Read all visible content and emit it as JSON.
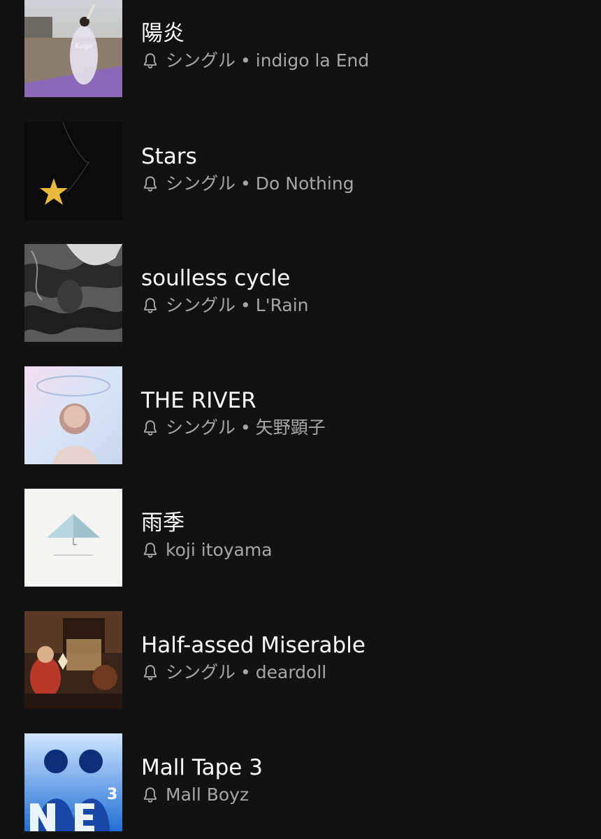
{
  "colors": {
    "background": "#121212",
    "title": "#ffffff",
    "subtitle": "#a7a7a7"
  },
  "icons": {
    "notification": "bell-icon"
  },
  "releases": [
    {
      "title": "陽炎",
      "type": "シングル",
      "separator": "•",
      "artist": "indigo la End"
    },
    {
      "title": "Stars",
      "type": "シングル",
      "separator": "•",
      "artist": "Do Nothing"
    },
    {
      "title": "soulless cycle",
      "type": "シングル",
      "separator": "•",
      "artist": "L'Rain"
    },
    {
      "title": "THE RIVER",
      "type": "シングル",
      "separator": "•",
      "artist": "矢野顕子"
    },
    {
      "title": "雨季",
      "artist": "koji itoyama"
    },
    {
      "title": "Half-assed Miserable",
      "type": "シングル",
      "separator": "•",
      "artist": "deardoll"
    },
    {
      "title": "Mall Tape 3",
      "artist": "Mall Boyz"
    }
  ]
}
